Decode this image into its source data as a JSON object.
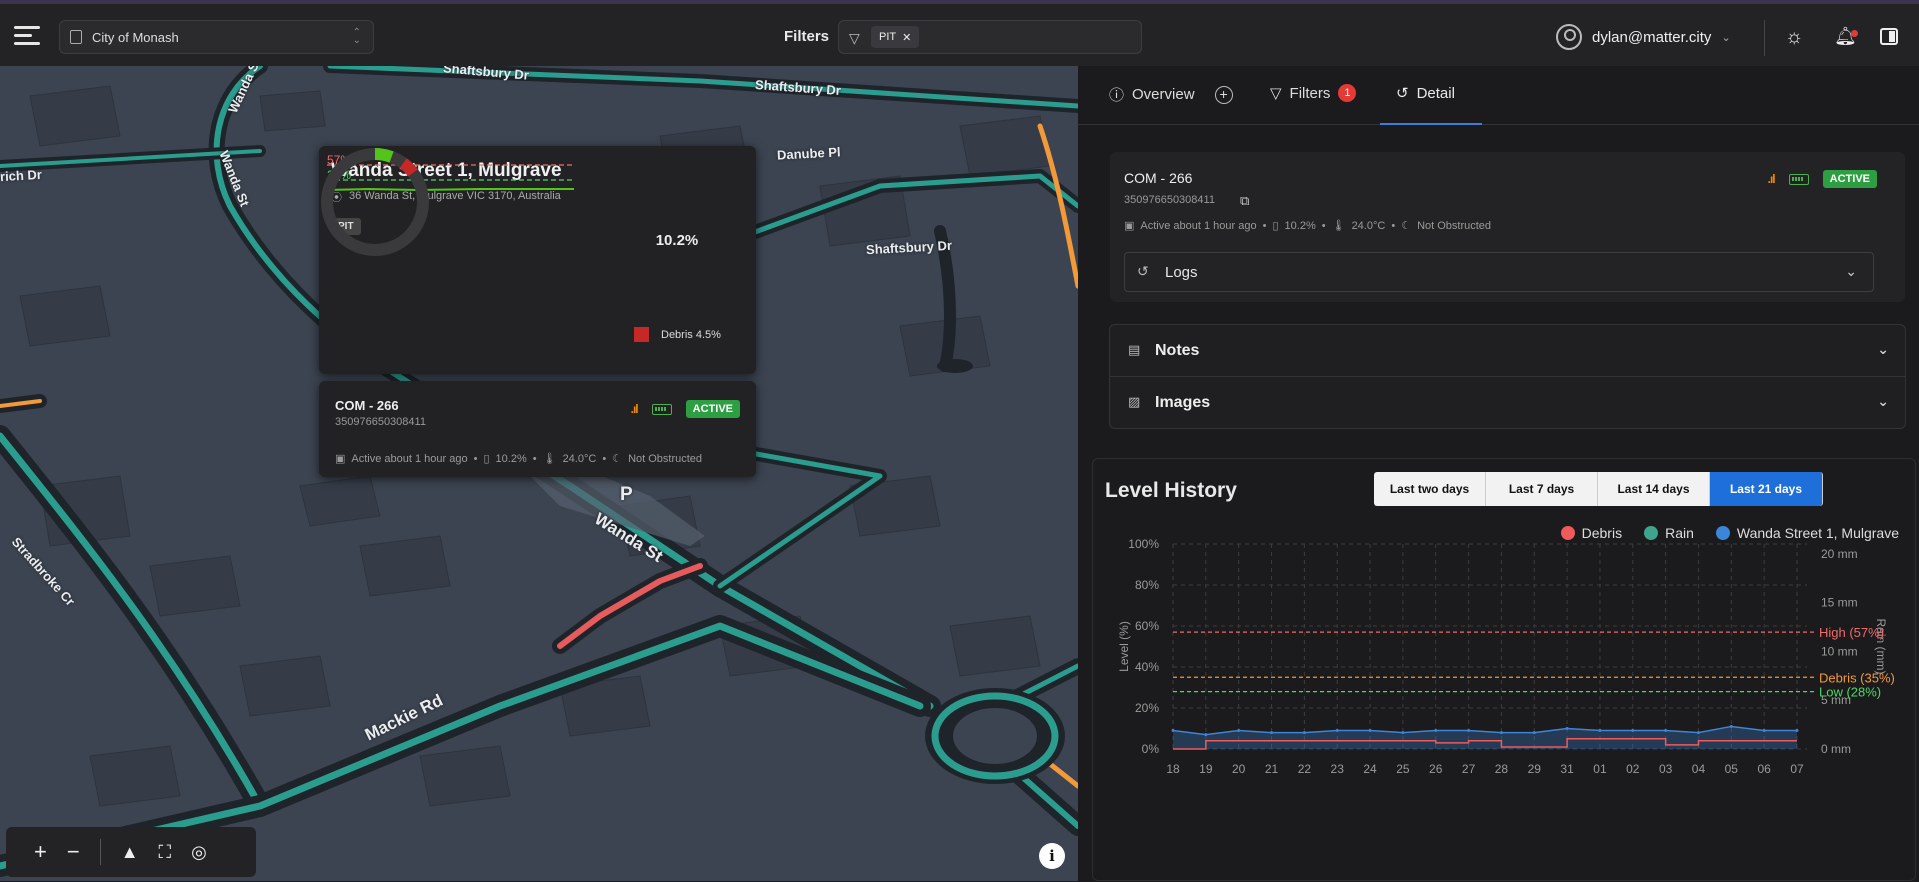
{
  "topbar": {
    "council": "City of Monash",
    "filters_label": "Filters",
    "filter_chip": "PIT",
    "user_email": "dylan@matter.city"
  },
  "map": {
    "road_labels": [
      "Shaftsbury Dr",
      "Wanda St",
      "rich Dr",
      "Wanda St",
      "Danube Pl",
      "Shaftsbury Dr",
      "Stradbroke Cr",
      "Wanda St",
      "Mackie Rd",
      "Shaftsbury Dr",
      "P"
    ],
    "popup": {
      "title": "Wanda Street 1, Mulgrave",
      "address": "36 Wanda St, Mulgrave VIC 3170, Australia",
      "badge": "PIT",
      "high_label": "57%",
      "low_label": "28%",
      "donut_value": "10.2%",
      "donut_fraction": 0.102,
      "legend_label": "Debris 4.5%"
    },
    "device_popup": {
      "name": "COM - 266",
      "imei": "350976650308411",
      "status": "ACTIVE",
      "active": "Active about 1 hour ago",
      "level": "10.2%",
      "temp": "24.0°C",
      "obstruction": "Not Obstructed"
    },
    "colors": {
      "road_teal": "#2a9d8f",
      "road_red": "#e65b5b",
      "marker": "#52c41a"
    }
  },
  "panel": {
    "tabs": [
      {
        "label": "Overview"
      },
      {
        "label": "Filters",
        "count": "1"
      },
      {
        "label": "Detail"
      }
    ],
    "device": {
      "name": "COM - 266",
      "imei": "350976650308411",
      "status": "ACTIVE",
      "active": "Active about 1 hour ago",
      "level": "10.2%",
      "temp": "24.0°C",
      "obstruction": "Not Obstructed",
      "logs_label": "Logs"
    },
    "notes_label": "Notes",
    "images_label": "Images",
    "level_history": {
      "title": "Level History",
      "ranges": [
        "Last two days",
        "Last 7 days",
        "Last 14 days",
        "Last 21 days"
      ],
      "selected_range": "Last 21 days"
    }
  },
  "chart_data": {
    "type": "area",
    "title": "Level History",
    "ylabel": "Level (%)",
    "y2label": "Rain (mm)",
    "ylim": [
      0,
      100
    ],
    "y2lim": [
      0,
      21
    ],
    "yticks": [
      "0%",
      "20%",
      "40%",
      "60%",
      "80%",
      "100%"
    ],
    "y2ticks": [
      "0 mm",
      "5 mm",
      "10 mm",
      "15 mm",
      "20 mm"
    ],
    "categories": [
      "18",
      "19",
      "20",
      "21",
      "22",
      "23",
      "24",
      "25",
      "26",
      "27",
      "28",
      "29",
      "31",
      "01",
      "02",
      "03",
      "04",
      "05",
      "06",
      "07"
    ],
    "legend": [
      {
        "name": "Debris",
        "color": "#ef5b5b"
      },
      {
        "name": "Rain",
        "color": "#3fa48e"
      },
      {
        "name": "Wanda Street 1, Mulgrave",
        "color": "#3d85d8"
      }
    ],
    "thresholds": [
      {
        "label": "High (57%)",
        "value": 57,
        "color": "#ef6b6b"
      },
      {
        "label": "Debris (35%)",
        "value": 35,
        "color": "#f29a3a"
      },
      {
        "label": "Low (28%)",
        "value": 28,
        "color": "#4cd964"
      }
    ],
    "series": [
      {
        "name": "Wanda Street 1, Mulgrave",
        "values": [
          9,
          7,
          9,
          8,
          8,
          9,
          9,
          8,
          9,
          9,
          8,
          8,
          10,
          9,
          9,
          9,
          8,
          11,
          9,
          9
        ]
      },
      {
        "name": "Debris",
        "values": [
          0,
          4,
          4,
          4,
          4,
          4,
          4,
          4,
          3,
          4,
          1,
          1,
          5,
          5,
          5,
          2,
          4,
          4,
          4,
          4
        ]
      }
    ],
    "grid": true,
    "legend_position": "top-right"
  }
}
